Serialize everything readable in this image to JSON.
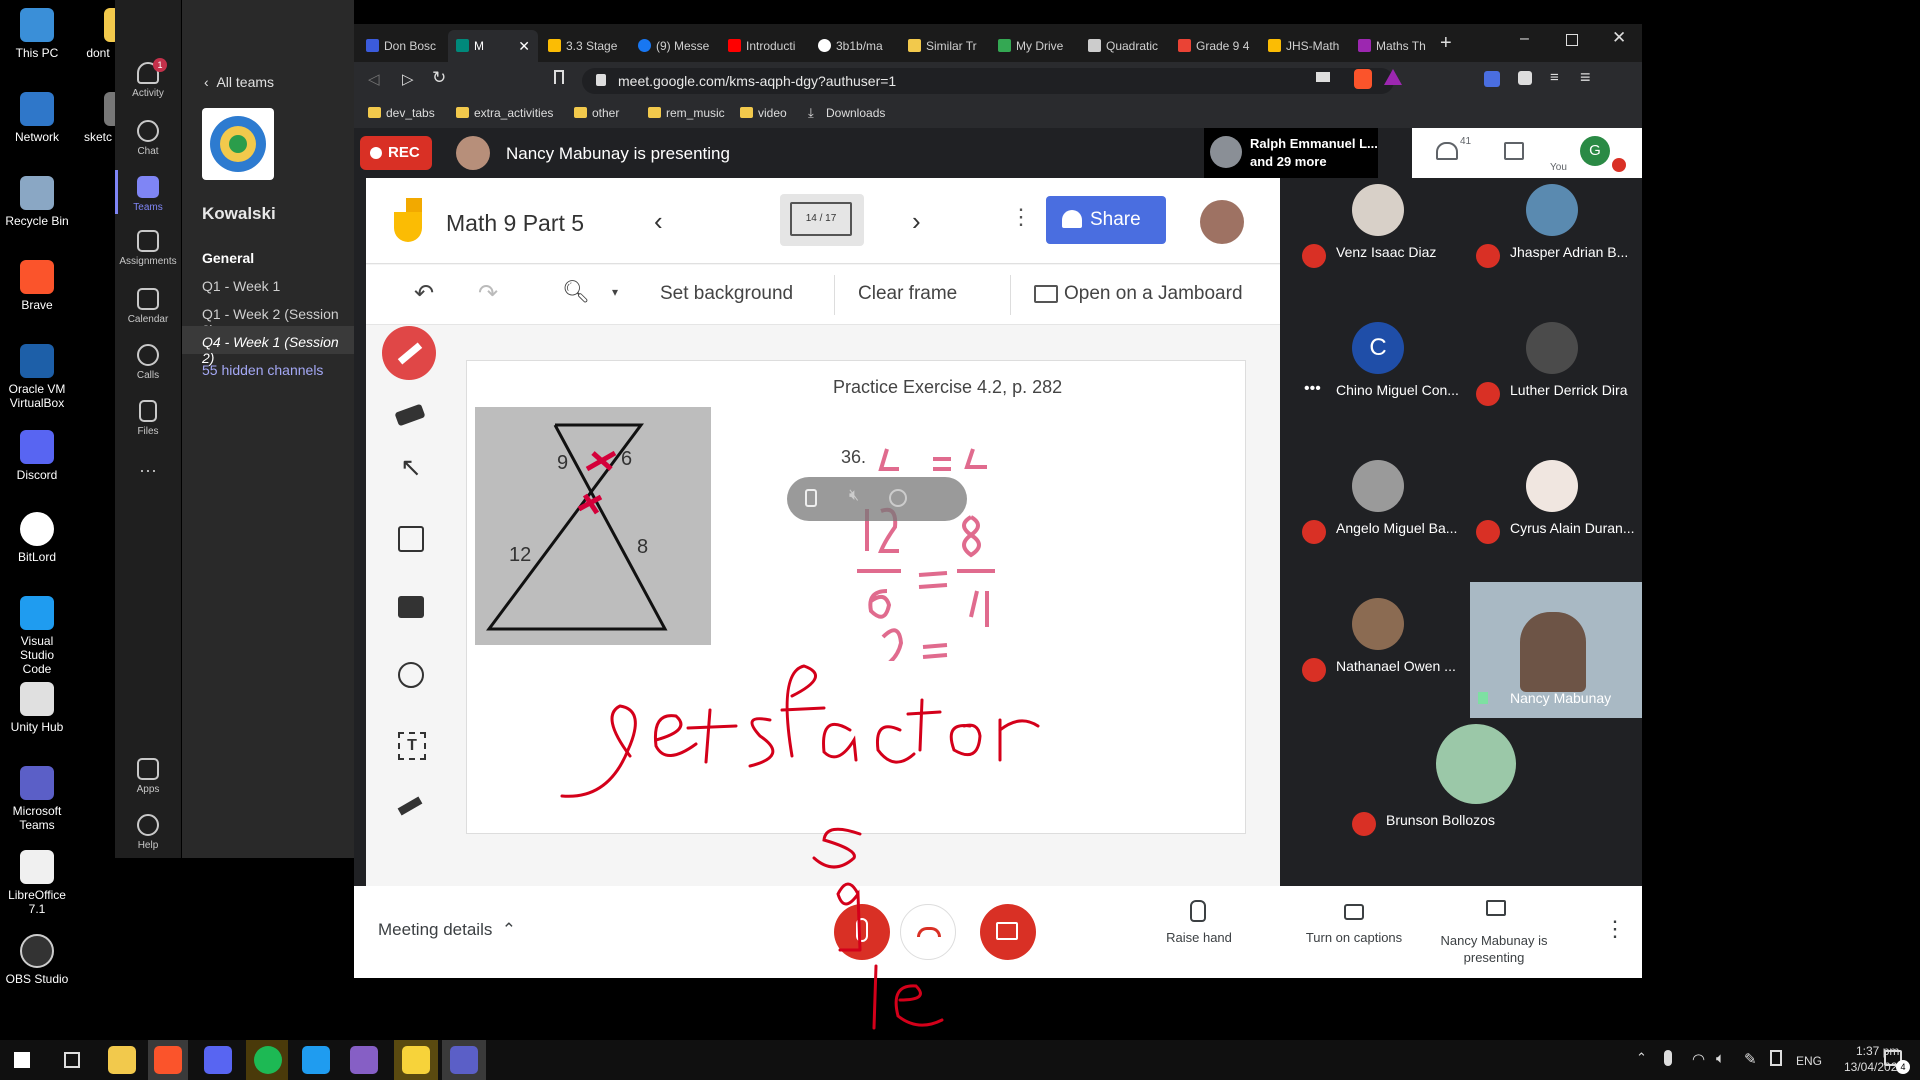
{
  "desktop": {
    "icons": [
      "This PC",
      "Network",
      "Recycle Bin",
      "Brave",
      "Oracle VM VirtualBox",
      "Discord",
      "BitLord",
      "Visual Studio Code",
      "Unity Hub",
      "Microsoft Teams",
      "LibreOffice 7.1",
      "OBS Studio"
    ],
    "extra_icons": [
      "dont",
      "sketc"
    ]
  },
  "teams": {
    "rail": [
      "Activity",
      "Chat",
      "Teams",
      "Assignments",
      "Calendar",
      "Calls",
      "Files",
      "Apps",
      "Help"
    ],
    "activity_badge": "1",
    "back_label": "All teams",
    "team_name": "Kowalski",
    "section": "General",
    "channels": [
      "Q1 - Week 1",
      "Q1 - Week 2 (Session 2)",
      "Q4 - Week 1 (Session 2)"
    ],
    "hidden": "55 hidden channels"
  },
  "browser": {
    "tabs": [
      "Don Bosc",
      "M",
      "3.3 Stage",
      "(9) Messe",
      "Introducti",
      "3b1b/ma",
      "Similar Tr",
      "My Drive",
      "Quadratic",
      "Grade 9 4",
      "JHS-Math",
      "Maths Th"
    ],
    "url": "meet.google.com/kms-aqph-dgy?authuser=1",
    "bookmarks": [
      "dev_tabs",
      "extra_activities",
      "other",
      "rem_music",
      "video",
      "Downloads"
    ]
  },
  "meet": {
    "rec": "REC",
    "presenting": "Nancy Mabunay is presenting",
    "top_participant": "Ralph Emmanuel L...",
    "top_more": "and 29 more",
    "people_count": "41",
    "you": "You",
    "you_initial": "G",
    "participants": [
      {
        "name": "Venz Isaac Diaz"
      },
      {
        "name": "Jhasper Adrian B..."
      },
      {
        "name": "Chino Miguel Con...",
        "initial": "C"
      },
      {
        "name": "Luther Derrick Dira"
      },
      {
        "name": "Angelo Miguel Ba..."
      },
      {
        "name": "Cyrus Alain Duran..."
      },
      {
        "name": "Nathanael Owen ..."
      },
      {
        "name": "Nancy Mabunay"
      },
      {
        "name": "Brunson Bollozos"
      }
    ],
    "meeting_details": "Meeting details",
    "raise_hand": "Raise hand",
    "captions": "Turn on captions",
    "presenting_label": "Nancy Mabunay is presenting"
  },
  "jamboard": {
    "title": "Math 9 Part 5",
    "frame": "14 / 17",
    "share": "Share",
    "set_background": "Set background",
    "clear_frame": "Clear frame",
    "open": "Open on a Jamboard",
    "exercise": "Practice Exercise 4.2, p. 282",
    "number": "36.",
    "fig_labels": [
      "9",
      "6",
      "12",
      "8"
    ]
  },
  "taskbar": {
    "time": "1:37 pm",
    "date": "13/04/2021",
    "lang": "ENG",
    "notif": "4"
  },
  "colors": {
    "rec": "#d93025",
    "share": "#4a6ee0",
    "ink": "#d4003a",
    "accent": "#6264a7"
  }
}
